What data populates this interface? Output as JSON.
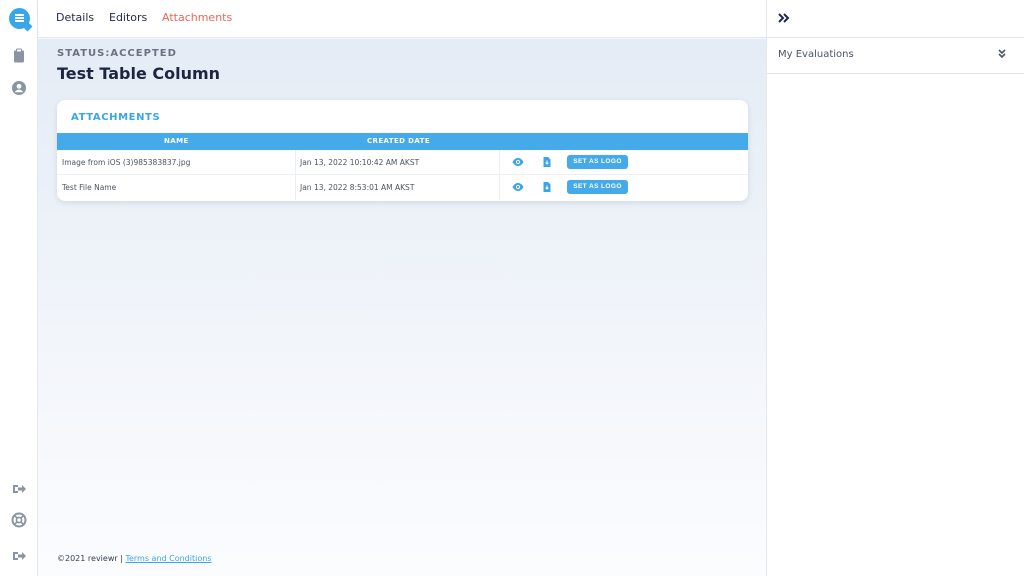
{
  "tabs": [
    {
      "label": "Details",
      "active": false
    },
    {
      "label": "Editors",
      "active": false
    },
    {
      "label": "Attachments",
      "active": true
    }
  ],
  "page": {
    "status": "STATUS:ACCEPTED",
    "title": "Test Table Column"
  },
  "attachments": {
    "heading": "ATTACHMENTS",
    "columns": {
      "name": "NAME",
      "created": "CREATED DATE"
    },
    "rows": [
      {
        "name": "Image from iOS (3)985383837.jpg",
        "created": "Jan 13, 2022 10:10:42 AM AKST",
        "action": "SET AS LOGO"
      },
      {
        "name": "Test File Name",
        "created": "Jan 13, 2022 8:53:01 AM AKST",
        "action": "SET AS LOGO"
      }
    ]
  },
  "footer": {
    "copyright": "©2021 reviewr |",
    "terms": "Terms and Conditions"
  },
  "right_panel": {
    "title": "My Evaluations"
  },
  "icons": {
    "rail": [
      "app-logo-icon",
      "clipboard-icon",
      "user-circle-icon",
      "sign-out-icon",
      "lifebuoy-icon",
      "logout-icon"
    ],
    "row_actions": [
      "eye-icon",
      "file-download-icon"
    ],
    "panel": [
      "chevrons-right-icon",
      "chevrons-down-icon"
    ]
  },
  "colors": {
    "accent": "#3aa6ea",
    "active_tab": "#e8675a",
    "table_header": "#45aaea"
  }
}
